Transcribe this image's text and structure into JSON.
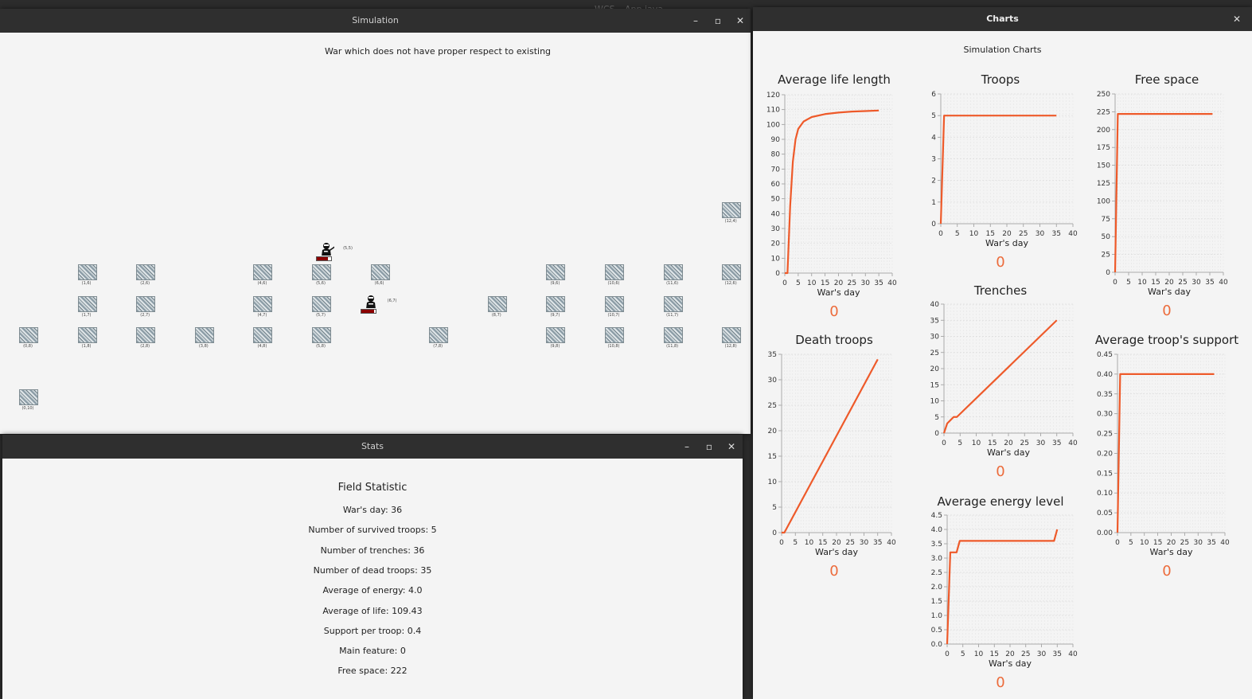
{
  "desktop_title": "WCS – App.java",
  "simulation": {
    "window_title": "Simulation",
    "heading": "War which does not have proper respect to existing",
    "tiles": [
      {
        "label": "(12,4)",
        "col": 12,
        "row": 4
      },
      {
        "label": "(1,6)",
        "col": 1,
        "row": 6
      },
      {
        "label": "(2,6)",
        "col": 2,
        "row": 6
      },
      {
        "label": "(4,6)",
        "col": 4,
        "row": 6
      },
      {
        "label": "(5,6)",
        "col": 5,
        "row": 6
      },
      {
        "label": "(6,6)",
        "col": 6,
        "row": 6
      },
      {
        "label": "(9,6)",
        "col": 9,
        "row": 6
      },
      {
        "label": "(10,6)",
        "col": 10,
        "row": 6
      },
      {
        "label": "(11,6)",
        "col": 11,
        "row": 6
      },
      {
        "label": "(12,6)",
        "col": 12,
        "row": 6
      },
      {
        "label": "(1,7)",
        "col": 1,
        "row": 7
      },
      {
        "label": "(2,7)",
        "col": 2,
        "row": 7
      },
      {
        "label": "(4,7)",
        "col": 4,
        "row": 7
      },
      {
        "label": "(5,7)",
        "col": 5,
        "row": 7
      },
      {
        "label": "(8,7)",
        "col": 8,
        "row": 7
      },
      {
        "label": "(9,7)",
        "col": 9,
        "row": 7
      },
      {
        "label": "(10,7)",
        "col": 10,
        "row": 7
      },
      {
        "label": "(11,7)",
        "col": 11,
        "row": 7
      },
      {
        "label": "(0,8)",
        "col": 0,
        "row": 8
      },
      {
        "label": "(1,8)",
        "col": 1,
        "row": 8
      },
      {
        "label": "(2,8)",
        "col": 2,
        "row": 8
      },
      {
        "label": "(3,8)",
        "col": 3,
        "row": 8
      },
      {
        "label": "(4,8)",
        "col": 4,
        "row": 8
      },
      {
        "label": "(5,8)",
        "col": 5,
        "row": 8
      },
      {
        "label": "(7,8)",
        "col": 7,
        "row": 8
      },
      {
        "label": "(9,8)",
        "col": 9,
        "row": 8
      },
      {
        "label": "(10,8)",
        "col": 10,
        "row": 8
      },
      {
        "label": "(11,8)",
        "col": 11,
        "row": 8
      },
      {
        "label": "(12,8)",
        "col": 12,
        "row": 8
      },
      {
        "label": "(0,10)",
        "col": 0,
        "row": 10
      }
    ],
    "agents": [
      {
        "label": "(5,5)",
        "col": 5,
        "row": 5,
        "health": 0.8,
        "icon": "soldier-with-rifle-icon"
      },
      {
        "label": "(6,7)",
        "col": 6,
        "row": 7,
        "health": 0.9,
        "icon": "soldier-icon"
      }
    ]
  },
  "stats": {
    "window_title": "Stats",
    "heading": "Field Statistic",
    "lines": [
      "War's day: 36",
      "Number of survived troops: 5",
      "Number of trenches: 36",
      "Number of dead troops: 35",
      "Average of energy: 4.0",
      "Average of life: 109.43",
      "Support per troop: 0.4",
      "Main feature: 0",
      "Free space: 222"
    ]
  },
  "charts_window": {
    "window_title": "Charts",
    "heading": "Simulation Charts",
    "line_color": "#ee5a2a"
  },
  "chart_data": [
    {
      "type": "line",
      "title": "Average life length",
      "xlabel": "War's day",
      "ylabel": "",
      "counter": "0",
      "xlim": [
        0,
        40
      ],
      "ylim": [
        0,
        120
      ],
      "xticks": [
        0,
        5,
        10,
        15,
        20,
        25,
        30,
        35,
        40
      ],
      "yticks": [
        0,
        10,
        20,
        30,
        40,
        50,
        60,
        70,
        80,
        90,
        100,
        110,
        120
      ],
      "x": [
        0,
        1,
        2,
        3,
        4,
        5,
        7,
        10,
        15,
        20,
        25,
        30,
        35
      ],
      "y": [
        0,
        0,
        45,
        75,
        90,
        97,
        102,
        105,
        107,
        108,
        108.7,
        109,
        109.4
      ]
    },
    {
      "type": "line",
      "title": "Troops",
      "xlabel": "War's day",
      "ylabel": "",
      "counter": "0",
      "xlim": [
        0,
        40
      ],
      "ylim": [
        0,
        6
      ],
      "xticks": [
        0,
        5,
        10,
        15,
        20,
        25,
        30,
        35,
        40
      ],
      "yticks": [
        0,
        1,
        2,
        3,
        4,
        5,
        6
      ],
      "x": [
        0,
        1,
        35
      ],
      "y": [
        0,
        5,
        5
      ]
    },
    {
      "type": "line",
      "title": "Free space",
      "xlabel": "War's day",
      "ylabel": "",
      "counter": "0",
      "xlim": [
        0,
        40
      ],
      "ylim": [
        0,
        250
      ],
      "xticks": [
        0,
        5,
        10,
        15,
        20,
        25,
        30,
        35,
        40
      ],
      "yticks": [
        0,
        25,
        50,
        75,
        100,
        125,
        150,
        175,
        200,
        225,
        250
      ],
      "x": [
        0,
        1,
        36
      ],
      "y": [
        0,
        222,
        222
      ]
    },
    {
      "type": "line",
      "title": "Trenches",
      "xlabel": "War's day",
      "ylabel": "",
      "counter": "0",
      "xlim": [
        0,
        40
      ],
      "ylim": [
        0,
        40
      ],
      "xticks": [
        0,
        5,
        10,
        15,
        20,
        25,
        30,
        35,
        40
      ],
      "yticks": [
        0,
        5,
        10,
        15,
        20,
        25,
        30,
        35,
        40
      ],
      "x": [
        0,
        1,
        2,
        3,
        4,
        35
      ],
      "y": [
        0,
        3,
        4,
        5,
        5,
        35
      ]
    },
    {
      "type": "line",
      "title": "Death troops",
      "xlabel": "War's day",
      "ylabel": "",
      "counter": "0",
      "xlim": [
        0,
        40
      ],
      "ylim": [
        0,
        35
      ],
      "xticks": [
        0,
        5,
        10,
        15,
        20,
        25,
        30,
        35,
        40
      ],
      "yticks": [
        0,
        5,
        10,
        15,
        20,
        25,
        30,
        35
      ],
      "x": [
        0,
        1,
        35
      ],
      "y": [
        0,
        0,
        34
      ]
    },
    {
      "type": "line",
      "title": "Average troop's support",
      "xlabel": "War's day",
      "ylabel": "",
      "counter": "0",
      "xlim": [
        0,
        40
      ],
      "ylim": [
        0,
        0.45
      ],
      "xticks": [
        0,
        5,
        10,
        15,
        20,
        25,
        30,
        35,
        40
      ],
      "yticks": [
        "0.00",
        "0.05",
        "0.10",
        "0.15",
        "0.20",
        "0.25",
        "0.30",
        "0.35",
        "0.40",
        "0.45"
      ],
      "x": [
        0,
        1,
        36
      ],
      "y": [
        0,
        0.4,
        0.4
      ]
    },
    {
      "type": "line",
      "title": "Average energy level",
      "xlabel": "War's day",
      "ylabel": "",
      "counter": "0",
      "xlim": [
        0,
        40
      ],
      "ylim": [
        0,
        4.5
      ],
      "xticks": [
        0,
        5,
        10,
        15,
        20,
        25,
        30,
        35,
        40
      ],
      "yticks": [
        "0.0",
        "0.5",
        "1.0",
        "1.5",
        "2.0",
        "2.5",
        "3.0",
        "3.5",
        "4.0",
        "4.5"
      ],
      "x": [
        0,
        1,
        3,
        4,
        5,
        34,
        35
      ],
      "y": [
        0,
        3.2,
        3.2,
        3.6,
        3.6,
        3.6,
        4.0
      ]
    }
  ]
}
